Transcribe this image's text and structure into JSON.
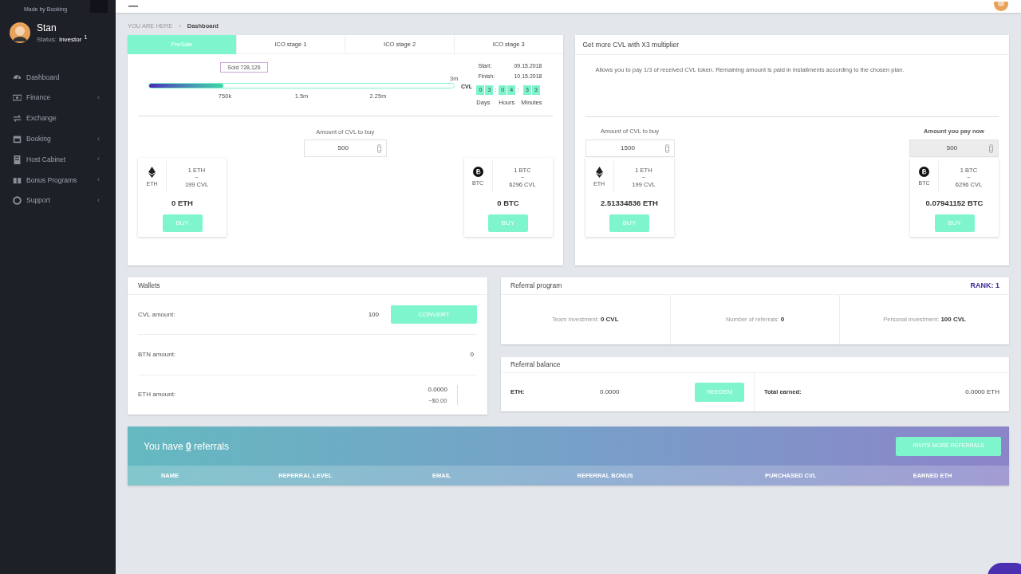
{
  "sidebar": {
    "brand_tagline": "Made by Booking",
    "user": {
      "name": "Stan",
      "status_label": "Status:",
      "status": "Investor",
      "status_mark": "1"
    },
    "items": [
      {
        "label": "Dashboard"
      },
      {
        "label": "Finance",
        "caret": "‹"
      },
      {
        "label": "Exchange"
      },
      {
        "label": "Booking",
        "caret": "‹"
      },
      {
        "label": "Host Cabinet",
        "caret": "‹"
      },
      {
        "label": "Bonus Programs",
        "caret": "‹"
      },
      {
        "label": "Support",
        "caret": "‹"
      }
    ]
  },
  "breadcrumb": {
    "prefix": "YOU ARE HERE",
    "separator": "›",
    "current": "Dashboard"
  },
  "sale": {
    "tabs": [
      {
        "label": "PreSale",
        "selected": true
      },
      {
        "label": "ICO stage 1",
        "selected": false
      },
      {
        "label": "ICO stage 2",
        "selected": false
      },
      {
        "label": "ICO stage 3",
        "selected": false
      }
    ],
    "progress": {
      "sold": "Sold 728,126",
      "level": 0.243,
      "unit": "CVL",
      "max_label": "3m",
      "ticks": [
        "750k",
        "1.5m",
        "2.25m"
      ]
    },
    "dates": [
      {
        "label": "Start:",
        "value": "09.15.2018"
      },
      {
        "label": "Finish:",
        "value": "10.15.2018"
      }
    ],
    "countdown": [
      {
        "digits": [
          "0",
          "3"
        ],
        "separator": ":",
        "label": "Days"
      },
      {
        "digits": [
          "0",
          "4"
        ],
        "separator": ":",
        "label": "Hours"
      },
      {
        "digits": [
          "3",
          "3"
        ],
        "label": "Minutes"
      }
    ],
    "amount_label": "Amount of CVL to buy",
    "amount": "500",
    "currencies": [
      {
        "kind": "eth",
        "code": "ETH",
        "rate_from": "1 ETH",
        "rate_sep": "~",
        "rate_to": "199 CVL",
        "total": "0 ETH",
        "button": "BUY"
      },
      {
        "kind": "btc",
        "code": "BTC",
        "rate_from": "1 BTC",
        "rate_sep": "~",
        "rate_to": "6296 CVL",
        "total": "0 BTC",
        "button": "BUY"
      }
    ]
  },
  "multiplier": {
    "title": "Get more CVL with X3 multiplier",
    "description": "Allows you to pay 1/3 of received CVL token. Remaining amount is paid in installments according to the chosen plan.",
    "amount_label": "Amount of CVL to buy",
    "amount": "1500",
    "pay_label": "Amount you pay now",
    "pay": "500",
    "currencies": [
      {
        "kind": "eth",
        "code": "ETH",
        "rate_from": "1 ETH",
        "rate_sep": "~",
        "rate_to": "199 CVL",
        "total": "2.51334836 ETH",
        "button": "BUY"
      },
      {
        "kind": "btc",
        "code": "BTC",
        "rate_from": "1 BTC",
        "rate_sep": "~",
        "rate_to": "6296 CVL",
        "total": "0.07941152 BTC",
        "button": "BUY"
      }
    ]
  },
  "wallets": {
    "title": "Wallets",
    "rows": [
      {
        "label": "CVL amount:",
        "value": "100",
        "button": "CONVERT"
      },
      {
        "label": "BTN amount:",
        "value": "0"
      },
      {
        "label": "ETH amount:",
        "value": "0.0000",
        "sub": "~$0.00"
      }
    ]
  },
  "referral_program": {
    "title": "Referral program",
    "rank": "RANK: 1",
    "stats": [
      {
        "label": "Team investment:",
        "value": "0 CVL"
      },
      {
        "label": "Number of referrals:",
        "value": "0"
      },
      {
        "label": "Personal investment:",
        "value": "100 CVL"
      }
    ]
  },
  "referral_balance": {
    "title": "Referral balance",
    "eth_label": "ETH:",
    "eth_value": "0.0000",
    "button": "REEDEM",
    "total_label": "Total earned:",
    "total_value": "0.0000 ETH"
  },
  "referrals": {
    "heading": "You have **0** referrals",
    "button": "INVITE MORE REFERRALS",
    "columns": [
      "NAME",
      "REFERRAL LEVEL",
      "EMAIL",
      "REFERRAL BONUS",
      "PURCHASED CVL",
      "EARNED ETH"
    ]
  }
}
